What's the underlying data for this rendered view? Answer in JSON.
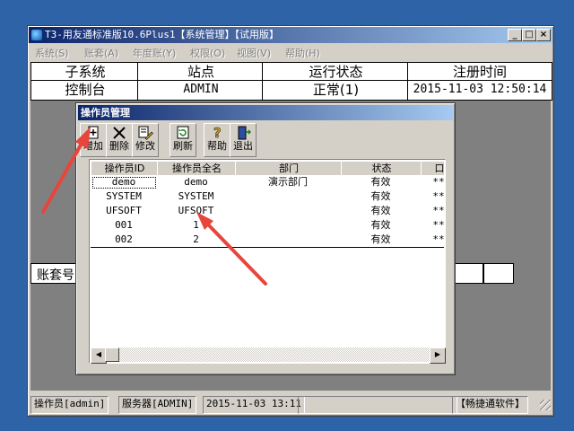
{
  "window": {
    "title": "T3-用友通标准版10.6Plus1【系统管理】【试用版】",
    "buttons": {
      "minimize": "_",
      "maximize": "□",
      "close": "×"
    }
  },
  "menu": [
    "系统(S)",
    "账套(A)",
    "年度账(Y)",
    "权限(O)",
    "视图(V)",
    "帮助(H)"
  ],
  "top_grid": {
    "headers": [
      "子系统",
      "站点",
      "运行状态",
      "注册时间"
    ],
    "row": [
      "控制台",
      "ADMIN",
      "正常(1)",
      "2015-11-03 12:50:14"
    ]
  },
  "account_strip": {
    "label": "账套号"
  },
  "dialog": {
    "title": "操作员管理",
    "toolbar": [
      {
        "name": "add",
        "label": "增加"
      },
      {
        "name": "delete",
        "label": "删除"
      },
      {
        "name": "edit",
        "label": "修改"
      },
      {
        "name": "refresh",
        "label": "刷新"
      },
      {
        "name": "help",
        "label": "帮助"
      },
      {
        "name": "exit",
        "label": "退出"
      }
    ],
    "table": {
      "columns": [
        "操作员ID",
        "操作员全名",
        "部门",
        "状态",
        "口"
      ],
      "rows": [
        [
          "demo",
          "demo",
          "演示部门",
          "有效",
          "**"
        ],
        [
          "SYSTEM",
          "SYSTEM",
          "",
          "有效",
          "**"
        ],
        [
          "UFSOFT",
          "UFSOFT",
          "",
          "有效",
          "**"
        ],
        [
          "001",
          "1",
          "",
          "有效",
          "**"
        ],
        [
          "002",
          "2",
          "",
          "有效",
          "**"
        ]
      ]
    }
  },
  "statusbar": {
    "operator": "操作员[admin]",
    "server": "服务器[ADMIN]",
    "datetime": "2015-11-03 13:11",
    "brand": "【畅捷通软件】"
  },
  "annotation_color": "#e8453c"
}
